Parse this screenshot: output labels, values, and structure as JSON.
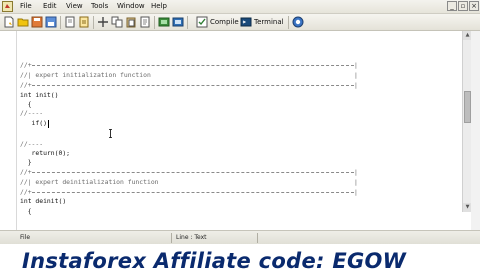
{
  "menubar": {
    "items": [
      "File",
      "Edit",
      "View",
      "Tools",
      "Window",
      "Help"
    ]
  },
  "toolbar": {
    "compile_label": "Compile",
    "terminal_label": "Terminal"
  },
  "editor": {
    "lines": [
      "//+",
      "//| expert initialization function",
      "//+",
      "int init()",
      "  {",
      "//----",
      "   if()",
      "//----",
      "   return(0);",
      "  }",
      "//+",
      "//| expert deinitialization function",
      "//+",
      "int deinit()",
      "  {"
    ],
    "rule_end": "|"
  },
  "statusbar": {
    "left": "File",
    "middle": "Line : Text"
  },
  "banner": {
    "text": "Instaforex Affiliate code: EGOW"
  }
}
